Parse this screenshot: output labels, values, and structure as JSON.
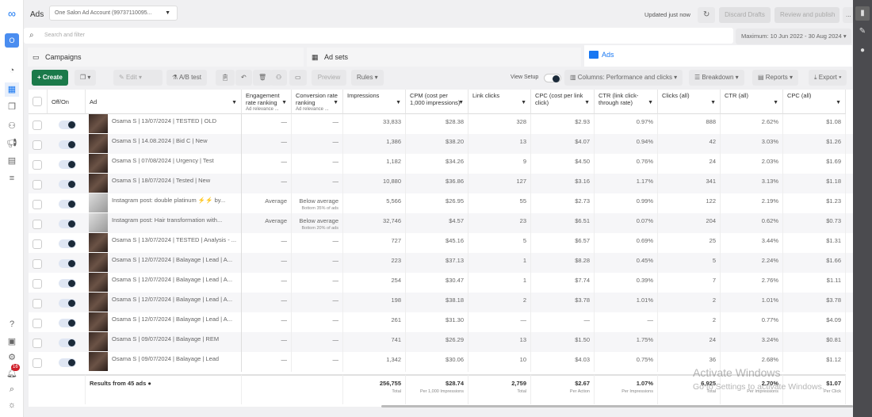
{
  "app": {
    "title": "Ads",
    "account": "One Salon Ad Account (99737110095...",
    "updated": "Updated just now",
    "discard": "Discard Drafts",
    "review": "Review and publish",
    "more": "...",
    "avatar": "O",
    "notif_count": "16"
  },
  "search": {
    "placeholder": "Search and filter",
    "date_range": "Maximum: 10 Jun 2022 - 30 Aug 2024"
  },
  "tabs": [
    {
      "label": "Campaigns"
    },
    {
      "label": "Ad sets"
    },
    {
      "label": "Ads",
      "active": true
    }
  ],
  "toolbar": {
    "create": "+ Create",
    "edit": "Edit",
    "ab_test": "A/B test",
    "preview": "Preview",
    "rules": "Rules",
    "view_setup": "View Setup",
    "columns": "Columns: Performance and clicks",
    "breakdown": "Breakdown",
    "reports": "Reports",
    "export": "Export"
  },
  "columns": [
    {
      "label": "Off/On"
    },
    {
      "label": "Ad"
    },
    {
      "label": "Engagement rate ranking",
      "sub": "Ad relevance ..."
    },
    {
      "label": "Conversion rate ranking",
      "sub": "Ad relevance ..."
    },
    {
      "label": "Impressions"
    },
    {
      "label": "CPM (cost per 1,000 impressions)"
    },
    {
      "label": "Link clicks"
    },
    {
      "label": "CPC (cost per link click)"
    },
    {
      "label": "CTR (link click-through rate)"
    },
    {
      "label": "Clicks (all)"
    },
    {
      "label": "CTR (all)"
    },
    {
      "label": "CPC (all)"
    }
  ],
  "rows": [
    {
      "ad": "Osama S | 13/07/2024 | TESTED | OLD",
      "eng": "—",
      "conv": "—",
      "imp": "33,833",
      "cpm": "$28.38",
      "lc": "328",
      "cpc": "$2.93",
      "ctr": "0.97%",
      "clicks": "888",
      "ctra": "2.62%",
      "cpca": "$1.08"
    },
    {
      "ad": "Osama S | 14.08.2024 | Bid C | New",
      "eng": "—",
      "conv": "—",
      "imp": "1,386",
      "cpm": "$38.20",
      "lc": "13",
      "cpc": "$4.07",
      "ctr": "0.94%",
      "clicks": "42",
      "ctra": "3.03%",
      "cpca": "$1.26"
    },
    {
      "ad": "Osama S | 07/08/2024 | Urgency | Test",
      "eng": "—",
      "conv": "—",
      "imp": "1,182",
      "cpm": "$34.26",
      "lc": "9",
      "cpc": "$4.50",
      "ctr": "0.76%",
      "clicks": "24",
      "ctra": "2.03%",
      "cpca": "$1.69"
    },
    {
      "ad": "Osama S | 18/07/2024 | Tested | New",
      "eng": "—",
      "conv": "—",
      "imp": "10,880",
      "cpm": "$36.86",
      "lc": "127",
      "cpc": "$3.16",
      "ctr": "1.17%",
      "clicks": "341",
      "ctra": "3.13%",
      "cpca": "$1.18"
    },
    {
      "ad": "Instagram post: double platinum ⚡⚡ by...",
      "eng": "Average",
      "conv": "Below average",
      "conv_sub": "Bottom 35% of ads",
      "imp": "5,566",
      "cpm": "$26.95",
      "lc": "55",
      "cpc": "$2.73",
      "ctr": "0.99%",
      "clicks": "122",
      "ctra": "2.19%",
      "cpca": "$1.23"
    },
    {
      "ad": "Instagram post: Hair transformation with...",
      "eng": "Average",
      "conv": "Below average",
      "conv_sub": "Bottom 20% of ads",
      "imp": "32,746",
      "cpm": "$4.57",
      "lc": "23",
      "cpc": "$6.51",
      "ctr": "0.07%",
      "clicks": "204",
      "ctra": "0.62%",
      "cpca": "$0.73"
    },
    {
      "ad": "Osama S | 13/07/2024 | TESTED | Analysis - ...",
      "eng": "—",
      "conv": "—",
      "imp": "727",
      "cpm": "$45.16",
      "lc": "5",
      "cpc": "$6.57",
      "ctr": "0.69%",
      "clicks": "25",
      "ctra": "3.44%",
      "cpca": "$1.31"
    },
    {
      "ad": "Osama S | 12/07/2024 | Balayage | Lead | A...",
      "eng": "—",
      "conv": "—",
      "imp": "223",
      "cpm": "$37.13",
      "lc": "1",
      "cpc": "$8.28",
      "ctr": "0.45%",
      "clicks": "5",
      "ctra": "2.24%",
      "cpca": "$1.66"
    },
    {
      "ad": "Osama S | 12/07/2024 | Balayage | Lead | A...",
      "eng": "—",
      "conv": "—",
      "imp": "254",
      "cpm": "$30.47",
      "lc": "1",
      "cpc": "$7.74",
      "ctr": "0.39%",
      "clicks": "7",
      "ctra": "2.76%",
      "cpca": "$1.11"
    },
    {
      "ad": "Osama S | 12/07/2024 | Balayage | Lead | A...",
      "eng": "—",
      "conv": "—",
      "imp": "198",
      "cpm": "$38.18",
      "lc": "2",
      "cpc": "$3.78",
      "ctr": "1.01%",
      "clicks": "2",
      "ctra": "1.01%",
      "cpca": "$3.78"
    },
    {
      "ad": "Osama S | 12/07/2024 | Balayage | Lead | A...",
      "eng": "—",
      "conv": "—",
      "imp": "261",
      "cpm": "$31.30",
      "lc": "—",
      "cpc": "—",
      "ctr": "—",
      "clicks": "2",
      "ctra": "0.77%",
      "cpca": "$4.09"
    },
    {
      "ad": "Osama S | 09/07/2024 | Balayage | REM",
      "eng": "—",
      "conv": "—",
      "imp": "741",
      "cpm": "$26.29",
      "lc": "13",
      "cpc": "$1.50",
      "ctr": "1.75%",
      "clicks": "24",
      "ctra": "3.24%",
      "cpca": "$0.81"
    },
    {
      "ad": "Osama S | 09/07/2024 | Balayage | Lead",
      "eng": "—",
      "conv": "—",
      "imp": "1,342",
      "cpm": "$30.06",
      "lc": "10",
      "cpc": "$4.03",
      "ctr": "0.75%",
      "clicks": "36",
      "ctra": "2.68%",
      "cpca": "$1.12"
    }
  ],
  "totals": {
    "label": "Results from 45 ads",
    "imp": "256,755",
    "imp_sub": "Total",
    "cpm": "$28.74",
    "cpm_sub": "Per 1,000 Impressions",
    "lc": "2,759",
    "lc_sub": "Total",
    "cpc": "$2.67",
    "cpc_sub": "Per Action",
    "ctr": "1.07%",
    "ctr_sub": "Per Impressions",
    "clicks": "6,925",
    "clicks_sub": "Total",
    "ctra": "2.70%",
    "ctra_sub": "Per Impressions",
    "cpca": "$1.07",
    "cpca_sub": "Per Click"
  },
  "watermark": {
    "line1": "Activate Windows",
    "line2": "Go to Settings to activate Windows."
  },
  "colors": {
    "create": "#1b7a4a",
    "accent": "#1877f2",
    "right_panel": "#4b4b4f"
  }
}
